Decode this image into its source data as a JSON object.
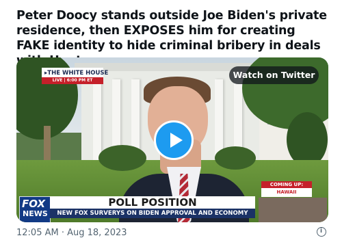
{
  "tweet": {
    "text": "Peter Doocy stands outside Joe Biden's private residence, then EXPOSES him for creating FAKE identity to hide criminal bribery in deals with Hunter",
    "timestamp": "12:05 AM · Aug 18, 2023"
  },
  "media": {
    "watch_label": "Watch on Twitter",
    "play_icon": "play-icon",
    "accent_color": "#1d9bf0"
  },
  "broadcast": {
    "location_tag": "THE WHITE HOUSE",
    "live_line": "LIVE | 6:00 PM ET",
    "coming_up_label": "COMING UP:",
    "coming_up_topic": "HAWAII WILDFIRES",
    "network_logo_top": "FOX",
    "network_logo_bottom": "NEWS",
    "headline": "POLL POSITION",
    "subheadline": "NEW FOX SURVERYS ON BIDEN APPROVAL AND ECONOMY"
  }
}
